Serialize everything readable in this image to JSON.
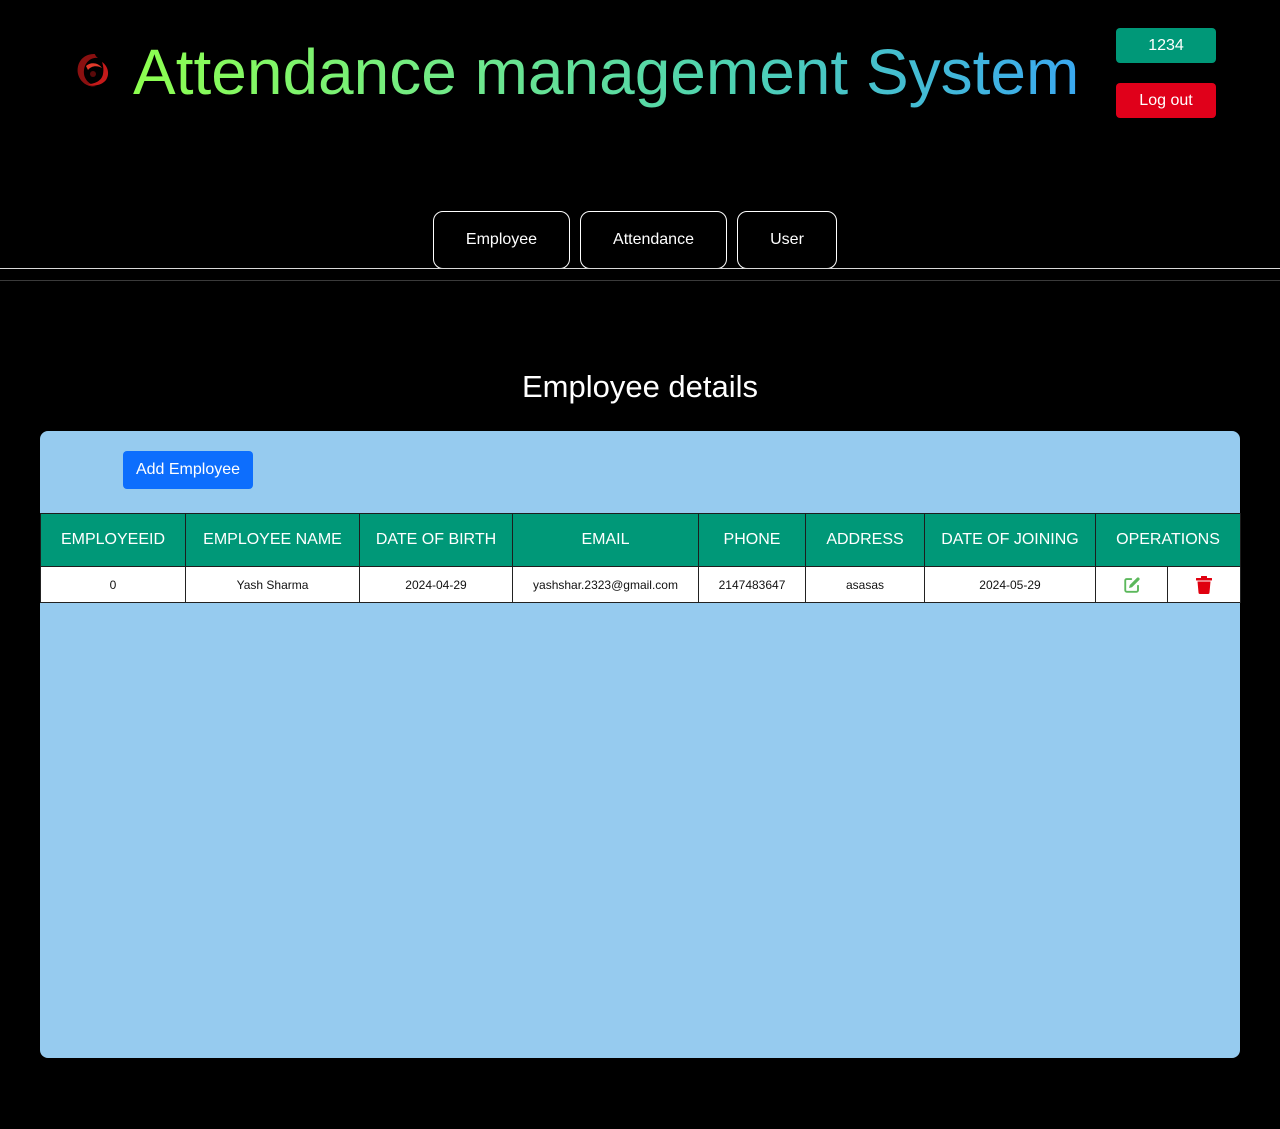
{
  "header": {
    "title": "Attendance management System",
    "logo": "phoenix-logo-icon",
    "user_id": "1234",
    "logout_label": "Log out"
  },
  "nav": {
    "items": [
      {
        "label": "Employee"
      },
      {
        "label": "Attendance"
      },
      {
        "label": "User"
      }
    ]
  },
  "section": {
    "title": "Employee details",
    "add_button_label": "Add Employee"
  },
  "table": {
    "columns": [
      "EMPLOYEEID",
      "EMPLOYEE NAME",
      "DATE OF BIRTH",
      "EMAIL",
      "PHONE",
      "ADDRESS",
      "DATE OF JOINING",
      "OPERATIONS"
    ],
    "rows": [
      {
        "employee_id": "0",
        "name": "Yash Sharma",
        "dob": "2024-04-29",
        "email": "yashshar.2323@gmail.com",
        "phone": "2147483647",
        "address": "asasas",
        "doj": "2024-05-29",
        "edit_icon": "edit-icon",
        "delete_icon": "trash-icon"
      }
    ]
  },
  "colors": {
    "background": "#000000",
    "user_badge": "#009878",
    "logout": "#e0001a",
    "panel": "#96cbef",
    "table_header": "#009878",
    "add_button": "#0d6efd",
    "edit_icon": "#5cb85c",
    "delete_icon": "#e0000f"
  }
}
